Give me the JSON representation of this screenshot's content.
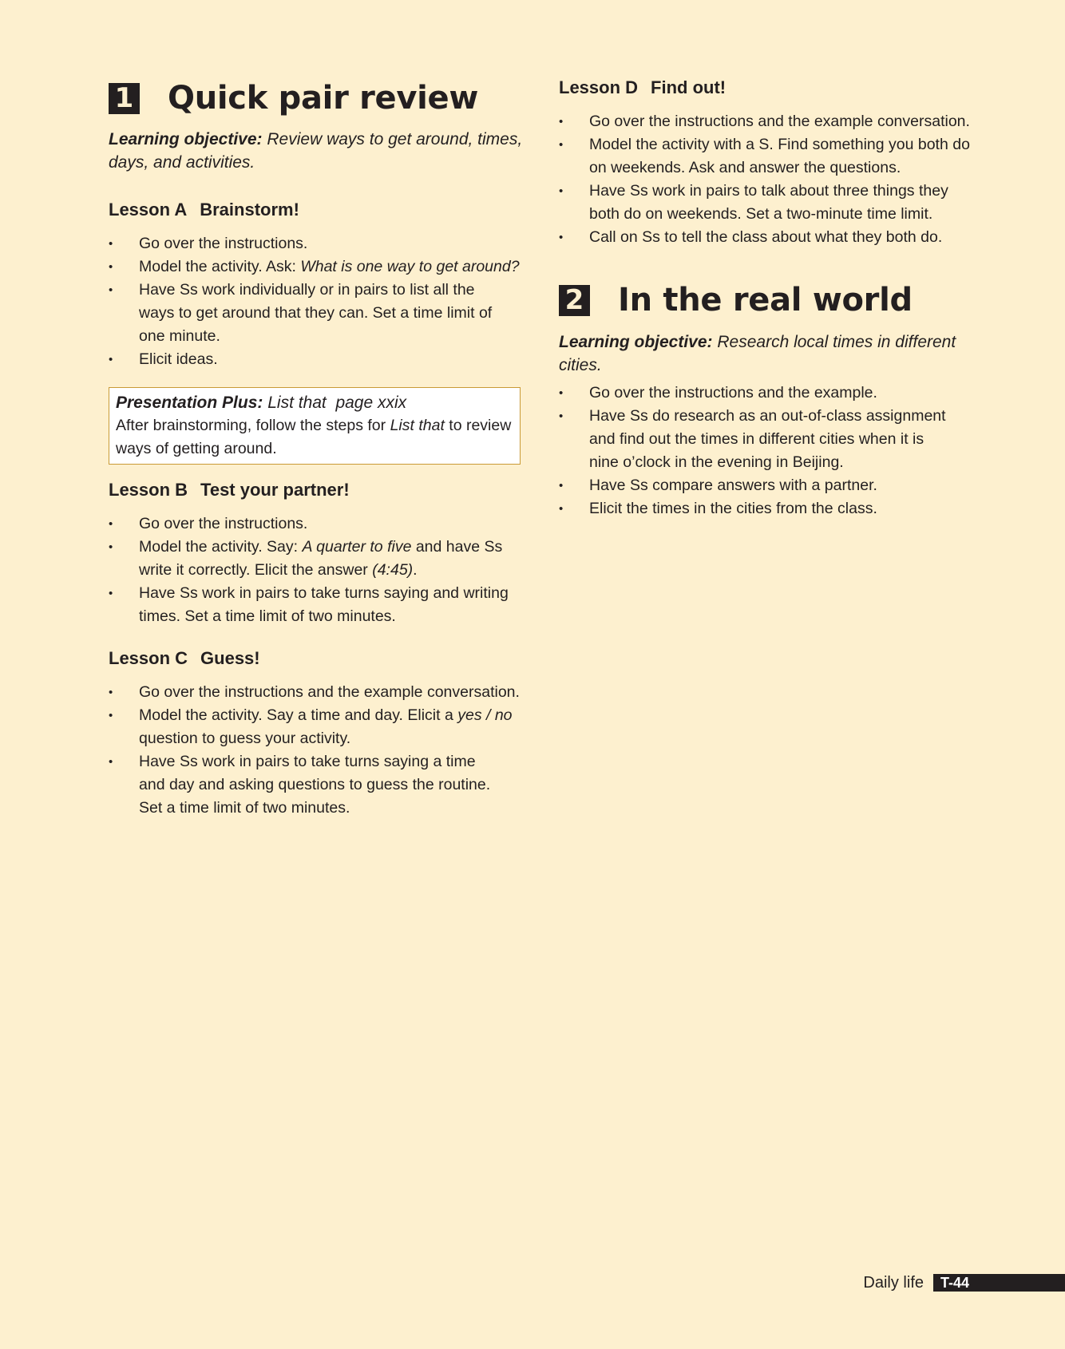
{
  "section1": {
    "number": "1",
    "title": "Quick pair review",
    "objective_label": "Learning objective:",
    "objective_text": " Review ways to get around, times, days, and activities.",
    "lessonA": {
      "letter": "Lesson A",
      "title": "Brainstorm!",
      "items": [
        "Go over the instructions.",
        "Model the activity. Ask: ",
        "What is one way to get around?",
        "Have Ss work individually or in pairs to list all the ways to get around that they can. Set a time limit of one minute.",
        "Elicit ideas."
      ]
    },
    "presentation_plus": {
      "label": "Presentation Plus:",
      "title": " List that",
      "page": "page xxix",
      "body_pre": "After brainstorming, follow the steps for ",
      "body_em": "List that",
      "body_post": " to review ways of getting around."
    },
    "lessonB": {
      "letter": "Lesson B",
      "title": "Test your partner!",
      "item1": "Go over the instructions.",
      "item2_pre": "Model the activity. Say: ",
      "item2_em": "A quarter to five",
      "item2_mid": " and have Ss write it correctly. Elicit the answer ",
      "item2_em2": "(4:45)",
      "item2_post": ".",
      "item3": "Have Ss work in pairs to take turns saying and writing times. Set a time limit of two minutes."
    },
    "lessonC": {
      "letter": "Lesson C",
      "title": "Guess!",
      "item1": "Go over the instructions and the example conversation.",
      "item2_pre": "Model the activity. Say a time and day. Elicit a ",
      "item2_em": "yes / no",
      "item2_post": " question to guess your activity.",
      "item3": "Have Ss work in pairs to take turns saying a time and day and asking questions to guess the routine. Set a time limit of two minutes."
    }
  },
  "lessonD": {
    "letter": "Lesson D",
    "title": "Find out!",
    "items": [
      "Go over the instructions and the example conversation.",
      "Model the activity with a S. Find something you both do on weekends. Ask and answer the questions.",
      "Have Ss work in pairs to talk about three things they both do on weekends. Set a two-minute time limit.",
      "Call on Ss to tell the class about what they both do."
    ]
  },
  "section2": {
    "number": "2",
    "title": "In the real world",
    "objective_label": "Learning objective:",
    "objective_text": " Research local times in different cities.",
    "items": [
      "Go over the instructions and the example.",
      "Have Ss do research as an out-of-class assignment and find out the times in different cities when it is nine o’clock in the evening in Beijing.",
      "Have Ss compare answers with a partner.",
      "Elicit the times in the cities from the class."
    ]
  },
  "footer": {
    "unit": "Daily life",
    "page": "T-44"
  },
  "colors": {
    "background": "#fdf0cf",
    "text": "#231f20",
    "box_border": "#c99a35"
  }
}
